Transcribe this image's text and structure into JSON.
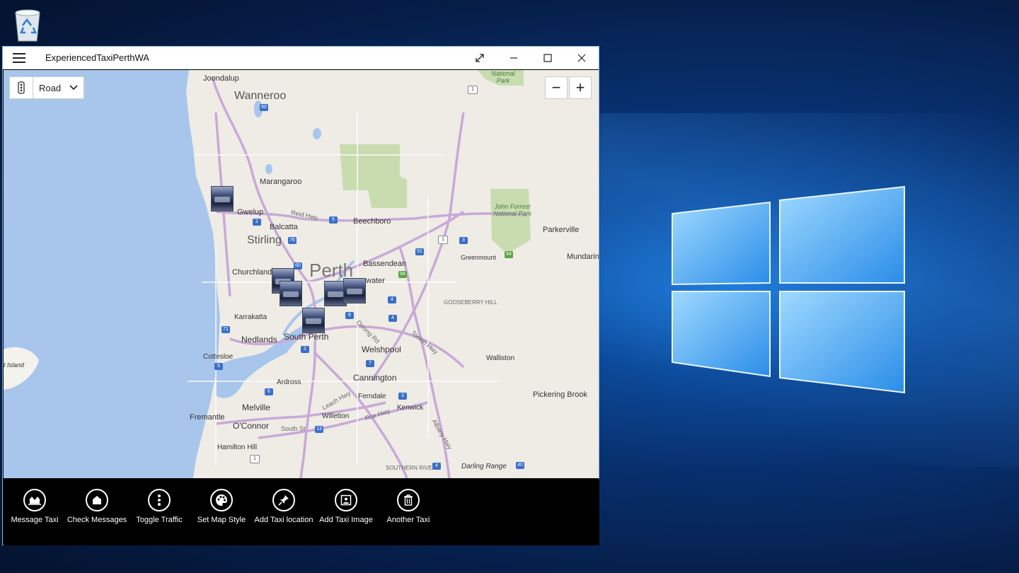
{
  "app": {
    "title": "ExperiencedTaxiPerthWA"
  },
  "map": {
    "style_selected": "Road",
    "zoom_out": "−",
    "zoom_in": "+",
    "labels": {
      "joondalup": "Joondalup",
      "wanneroo": "Wanneroo",
      "marangaroo": "Marangaroo",
      "gwelup": "Gwelup",
      "balcatta": "Balcatta",
      "stirling": "Stirling",
      "reid_hwy": "Reid Hwy",
      "beechboro": "Beechboro",
      "churchlands": "Churchlands",
      "perth": "Perth",
      "bassendean": "Bassendean",
      "bayswater": "water",
      "karrakatta": "Karrakatta",
      "nedlands": "Nedlands",
      "south_perth": "South Perth",
      "welshpool": "Welshpool",
      "cottesloe": "Cottesloe",
      "cannington": "Cannington",
      "ardross": "Ardross",
      "ferndale": "Ferndale",
      "melville": "Melville",
      "kenwick": "Kenwick",
      "fremantle": "Fremantle",
      "oconnor": "O'Connor",
      "willetton": "Willetton",
      "roe_hwy": "Roe Hwy",
      "hamilton_hill": "Hamilton Hill",
      "southern_river": "SOUTHERN RIVER",
      "darling_range": "Darling Range",
      "walliston": "Walliston",
      "pickering_brook": "Pickering Brook",
      "parkerville": "Parkerville",
      "mundaring": "Mundarin",
      "greenmount": "Greenmount",
      "gooseberry_hill": "GOOSEBERRY HILL",
      "john_forrest": "John Forrest National Park",
      "national_park": "National Park",
      "rottnest": "t Island",
      "leach_hwy": "Leach Hwy",
      "orrong_rd": "Orrong Rd",
      "albany_hwy": "Albany Hwy",
      "tonkin_hwy": "Tonkin Hwy",
      "south_st": "South St"
    },
    "shields": [
      "60",
      "2",
      "5",
      "76",
      "3",
      "51",
      "1",
      "94",
      "60",
      "4",
      "4",
      "8",
      "7",
      "71",
      "5",
      "6",
      "3",
      "2",
      "13",
      "4",
      "40",
      "1",
      "94",
      "1"
    ]
  },
  "commands": [
    {
      "label": "Message Taxi",
      "icon": "message-taxi-icon"
    },
    {
      "label": "Check Messages",
      "icon": "check-messages-icon"
    },
    {
      "label": "Toggle Traffic",
      "icon": "toggle-traffic-icon"
    },
    {
      "label": "Set Map Style",
      "icon": "palette-icon"
    },
    {
      "label": "Add Taxi location",
      "icon": "pin-icon"
    },
    {
      "label": "Add Taxi Image",
      "icon": "image-icon"
    },
    {
      "label": "Another Taxi",
      "icon": "trash-icon"
    }
  ]
}
